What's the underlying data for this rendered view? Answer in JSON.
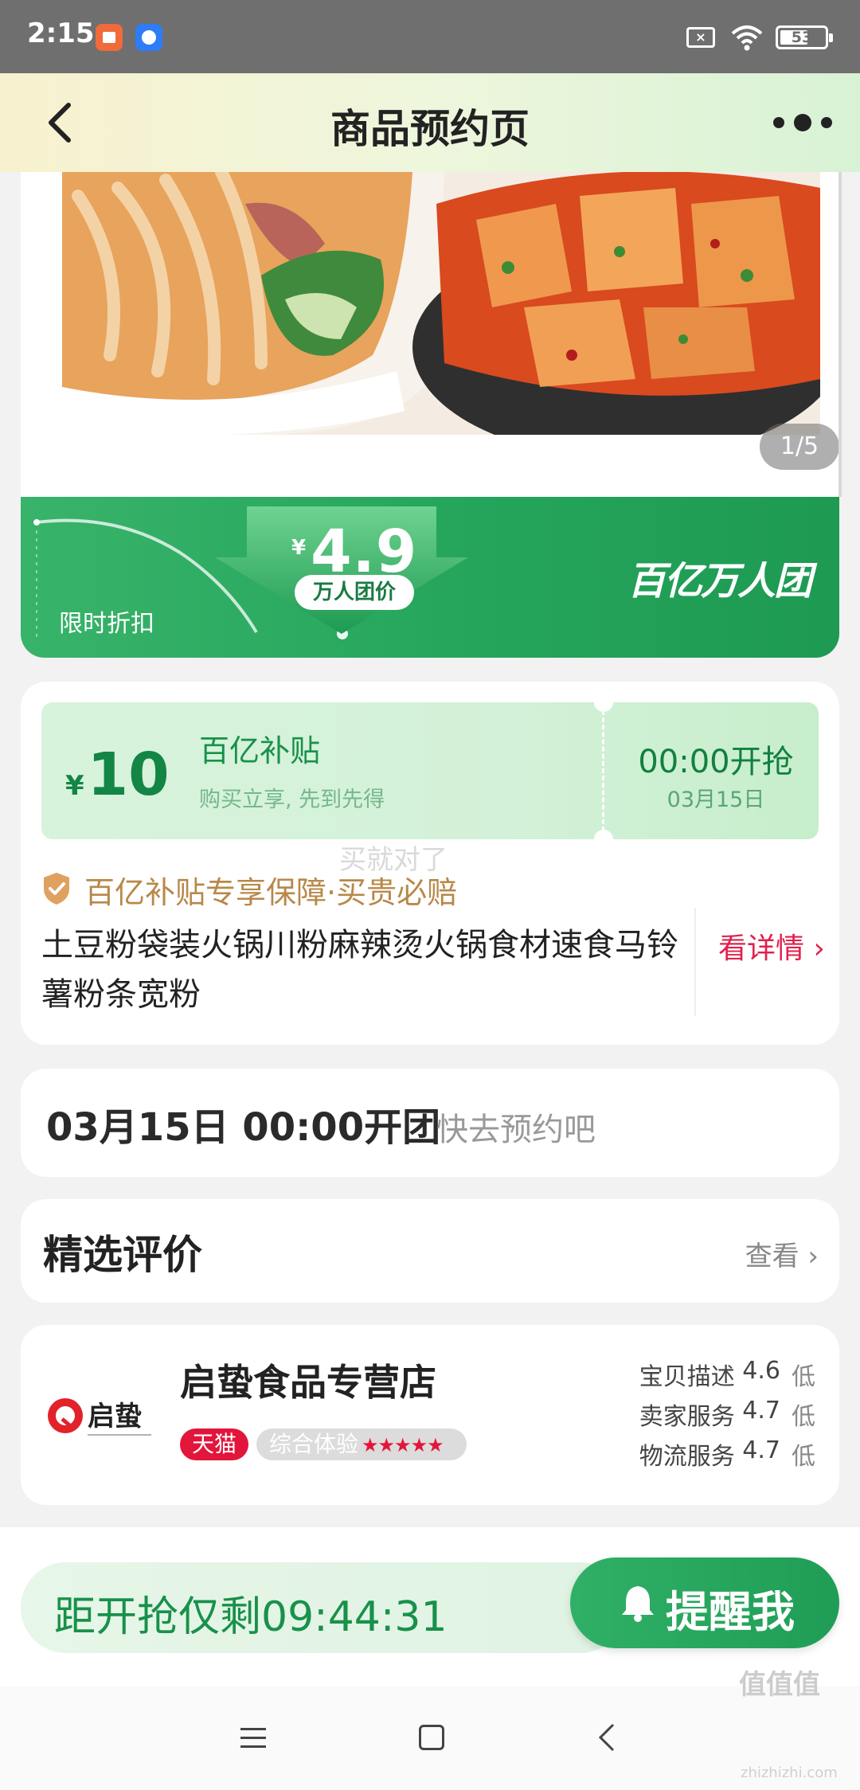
{
  "status_bar": {
    "time": "2:15",
    "battery": "53",
    "icons": [
      "app-icon-1",
      "baidu-app-icon",
      "no-sim-icon",
      "wifi-icon",
      "battery-icon"
    ]
  },
  "header": {
    "title": "商品预约页",
    "back_icon": "chevron-left-icon",
    "more_icon": "more-dots-icon"
  },
  "hero": {
    "index": "1/5"
  },
  "price_banner": {
    "label": "限时折扣",
    "currency": "¥",
    "price": "4.9",
    "tag": "万人团价",
    "brand": "百亿万人团",
    "colors": {
      "primary": "#25a55c"
    }
  },
  "coupon": {
    "currency": "¥",
    "amount": "10",
    "title": "百亿补贴",
    "subtitle": "购买立享, 先到先得",
    "start_time": "00:00开抢",
    "start_date": "03月15日"
  },
  "guarantee": {
    "overlay_text": "买就对了",
    "text": "百亿补贴专享保障·买贵必赔"
  },
  "product": {
    "title": "土豆粉袋装火锅川粉麻辣烫火锅食材速食马铃薯粉条宽粉",
    "detail_link": "看详情 ›"
  },
  "open_time": {
    "main": "03月15日 00:00开团",
    "sub": "快去预约吧"
  },
  "reviews": {
    "title": "精选评价",
    "link": "查看 ›"
  },
  "store": {
    "logo_text": "启蛰",
    "name": "启蛰食品专营店",
    "badge": "天猫",
    "experience_label": "综合体验",
    "experience_stars": "★★★★★",
    "scores": [
      {
        "label": "宝贝描述",
        "value": "4.6",
        "level": "低"
      },
      {
        "label": "卖家服务",
        "value": "4.7",
        "level": "低"
      },
      {
        "label": "物流服务",
        "value": "4.7",
        "level": "低"
      }
    ]
  },
  "bottom_bar": {
    "countdown": "距开抢仅剩09:44:31",
    "remind_label": "提醒我"
  },
  "watermark": {
    "text": "值值值",
    "sub": "zhizhizhi.com"
  }
}
